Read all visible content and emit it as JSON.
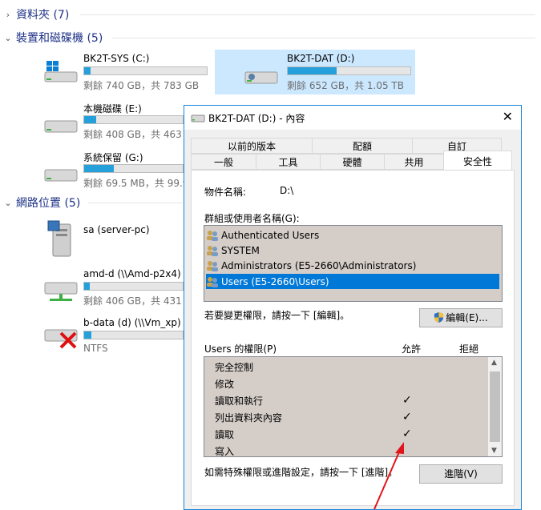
{
  "explorer": {
    "groups": [
      {
        "label": "資料夾 (7)"
      },
      {
        "label": "裝置和磁碟機 (5)"
      },
      {
        "label": "網路位置 (5)"
      }
    ],
    "drives": [
      {
        "name": "BK2T-SYS (C:)",
        "info": "剩餘 740 GB，共 783 GB",
        "used_fraction": 0.05
      },
      {
        "name": "BK2T-DAT (D:)",
        "info": "剩餘 652 GB，共 1.05 TB",
        "used_fraction": 0.4
      },
      {
        "name": "本機磁碟 (E:)",
        "info": "剩餘 408 GB，共 463 G",
        "used_fraction": 0.12
      },
      {
        "name": "系統保留 (G:)",
        "info": "剩餘 69.5 MB，共 99.9",
        "used_fraction": 0.3
      }
    ],
    "network": [
      {
        "name": "sa (server-pc)"
      },
      {
        "name": "amd-d (\\\\Amd-p2x4)",
        "info": "剩餘 406 GB，共 431 G",
        "used_fraction": 0.06
      },
      {
        "name": "b-data (d) (\\\\Vm_xp)",
        "info": "NTFS",
        "used_fraction": 0.07
      }
    ]
  },
  "dialog": {
    "title": "BK2T-DAT (D:) - 內容",
    "close": "✕",
    "tabs_row1": [
      "以前的版本",
      "配額",
      "自訂"
    ],
    "tabs_row2": [
      "一般",
      "工具",
      "硬體",
      "共用",
      "安全性"
    ],
    "object_name_label": "物件名稱:",
    "object_name_value": "D:\\",
    "groups_label": "群組或使用者名稱(G):",
    "users": [
      "Authenticated Users",
      "SYSTEM",
      "Administrators (E5-2660\\Administrators)",
      "Users (E5-2660\\Users)"
    ],
    "change_hint": "若要變更權限，請按一下 [編輯]。",
    "edit_button": "編輯(E)...",
    "permissions_label": "Users 的權限(P)",
    "allow_header": "允許",
    "deny_header": "拒絕",
    "permissions": [
      {
        "name": "完全控制",
        "allow": false,
        "deny": false
      },
      {
        "name": "修改",
        "allow": false,
        "deny": false
      },
      {
        "name": "讀取和執行",
        "allow": true,
        "deny": false
      },
      {
        "name": "列出資料夾內容",
        "allow": true,
        "deny": false
      },
      {
        "name": "讀取",
        "allow": true,
        "deny": false
      },
      {
        "name": "寫入",
        "allow": false,
        "deny": false
      }
    ],
    "advanced_hint": "如需特殊權限或進階設定，請按一下 [進階]。",
    "advanced_button": "進階(V)",
    "check_glyph": "✓"
  },
  "colors": {
    "accent": "#0078d7",
    "bar_fill": "#26a0da",
    "arrow": "#e0151b"
  }
}
